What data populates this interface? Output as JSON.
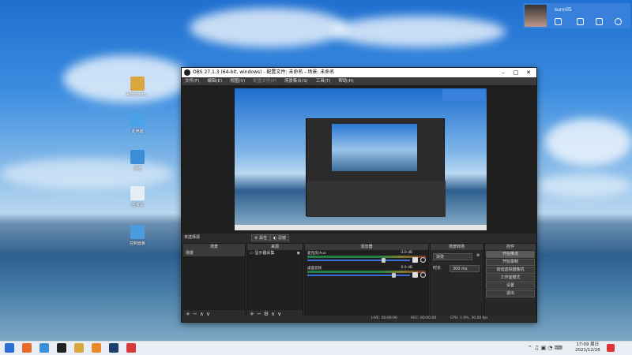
{
  "desktop": {
    "icons": [
      {
        "label": "Administr...",
        "color": "#d9a640"
      },
      {
        "label": "此电脑",
        "color": "#4aa3e8"
      },
      {
        "label": "网络",
        "color": "#3b8fd8"
      },
      {
        "label": "回收站",
        "color": "#e6eef5"
      },
      {
        "label": "控制面板",
        "color": "#4a9be0"
      }
    ]
  },
  "qq_panel": {
    "name": "sunnil5",
    "badge": "99"
  },
  "obs": {
    "title": "OBS 27.1.3 (64-bit, windows) - 配置文件: 未命名 - 场景: 未命名",
    "menu": [
      "文件(F)",
      "编辑(E)",
      "视图(V)",
      "配置文件(P)",
      "场景集合(S)",
      "工具(T)",
      "帮助(H)"
    ],
    "menu_disabled_index": 3,
    "no_selection": "未选择源",
    "tabs": {
      "properties": "属性",
      "filters": "滤镜"
    },
    "docks": {
      "scenes": {
        "title": "场景",
        "items": [
          "场景"
        ]
      },
      "sources": {
        "title": "来源",
        "items": [
          "显示器采集"
        ]
      },
      "mixer": {
        "title": "混音器",
        "channels": [
          {
            "name": "麦克风/Aux",
            "db": "-3.0 dB",
            "level": 0.72
          },
          {
            "name": "桌面音频",
            "db": "0.0 dB",
            "level": 0.82
          }
        ]
      },
      "transitions": {
        "title": "场景转场",
        "type": "渐变",
        "duration_label": "时长",
        "duration": "300 ms"
      },
      "controls": {
        "title": "控件",
        "buttons": [
          "开始推流",
          "开始录制",
          "启动虚拟摄像机",
          "工作室模式",
          "设置",
          "退出"
        ]
      }
    },
    "status": {
      "live": "LIVE: 00:00:00",
      "rec": "REC: 00:00:00",
      "cpu": "CPU: 1.0%, 30.00 fps"
    }
  },
  "taskbar": {
    "time": "17:09 周日",
    "date": "2021/12/26",
    "apps": [
      {
        "name": "windows",
        "color": "#2b6fd6"
      },
      {
        "name": "firefox",
        "color": "#e66a2a"
      },
      {
        "name": "app-blue",
        "color": "#3a8fd6"
      },
      {
        "name": "obs",
        "color": "#222222"
      },
      {
        "name": "app-orange",
        "color": "#d9a640"
      },
      {
        "name": "app-orange2",
        "color": "#e88a2a"
      },
      {
        "name": "steam",
        "color": "#1b3f6f"
      },
      {
        "name": "app-red",
        "color": "#d63a3a"
      }
    ]
  }
}
